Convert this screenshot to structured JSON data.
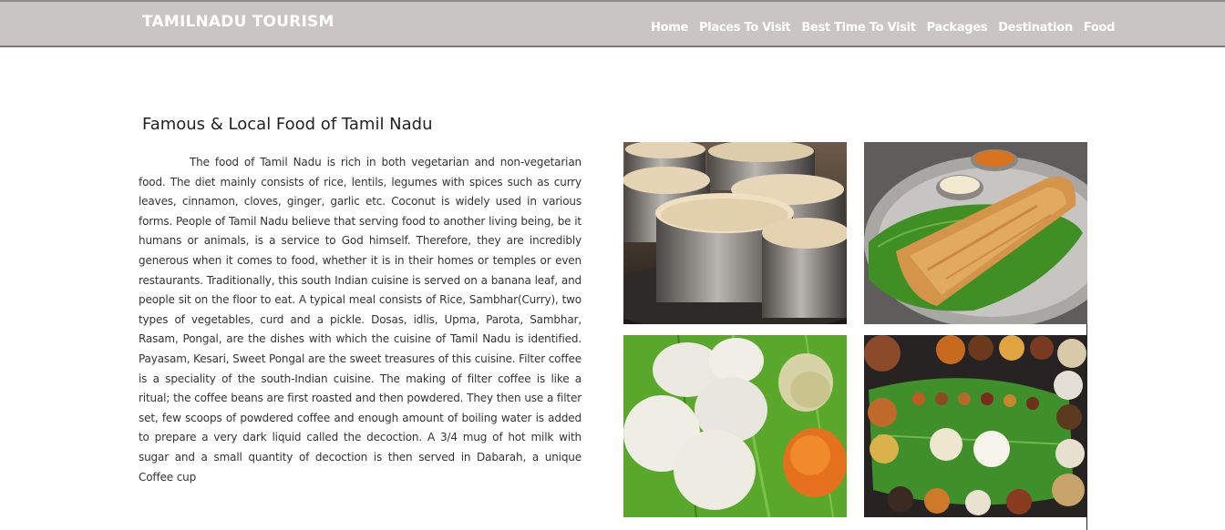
{
  "header": {
    "brand": "TAMILNADU TOURISM",
    "nav": [
      {
        "label": "Home"
      },
      {
        "label": "Places To Visit"
      },
      {
        "label": "Best Time To Visit"
      },
      {
        "label": "Packages"
      },
      {
        "label": "Destination"
      },
      {
        "label": "Food"
      }
    ]
  },
  "main": {
    "title": "Famous & Local Food of Tamil Nadu",
    "paragraph": "The food of Tamil Nadu is rich in both vegetarian and non-vegetarian food. The diet mainly consists of rice, lentils, legumes with spices such as curry leaves, cinnamon, cloves, ginger, garlic etc. Coconut is widely used in various forms. People of Tamil Nadu believe that serving food to another living being, be it humans or animals, is a service to God himself. Therefore, they are incredibly generous when it comes to food, whether it is in their homes or temples or even restaurants. Traditionally, this south Indian cuisine is served on a banana leaf, and people sit on the floor to eat. A typical meal consists of Rice, Sambhar(Curry), two types of vegetables, curd and a pickle. Dosas, idlis, Upma, Parota, Sambhar, Rasam, Pongal, are the dishes with which the cuisine of Tamil Nadu is identified. Payasam, Kesari, Sweet Pongal are the sweet treasures of this cuisine. Filter coffee is a speciality of the south-Indian cuisine. The making of filter coffee is like a ritual; the coffee beans are first roasted and then powdered. They then use a filter set, few scoops of powdered coffee and enough amount of boiling water is added to prepare a very dark liquid called the decoction. A 3/4 mug of hot milk with sugar and a small quantity of decoction is then served in Dabarah, a unique Coffee cup"
  },
  "gallery": {
    "images": [
      "filter-coffee-photo",
      "dosa-photo",
      "idli-photo",
      "banana-leaf-meal-photo"
    ]
  },
  "colors": {
    "navbar_bg": "#c8c5c4",
    "nav_text": "#ffffff",
    "body_text": "#333333",
    "leaf_green": "#4a9a2a"
  }
}
